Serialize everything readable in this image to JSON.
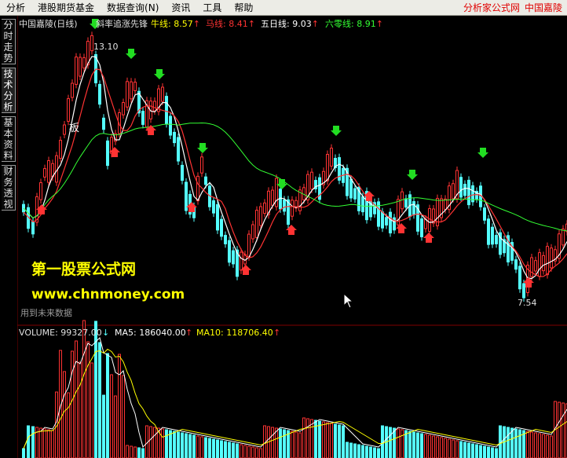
{
  "menu": {
    "items": [
      "分析",
      "港股期货基金",
      "数据查询(N)",
      "资讯",
      "工具",
      "帮助"
    ],
    "right_site": "分析家公式网",
    "right_stock": "中国嘉陵"
  },
  "side_tabs": [
    "分时走势",
    "技术分析",
    "基本资料",
    "财务透视"
  ],
  "header": {
    "stock": "中国嘉陵(日线)",
    "formula": "斜率追涨先锋",
    "lines": [
      {
        "label": "牛线:",
        "value": "8.57",
        "arrow": "↑",
        "color": "#ffff00"
      },
      {
        "label": "马线:",
        "value": "8.41",
        "arrow": "↑",
        "color": "#ff3333"
      },
      {
        "label": "五日线:",
        "value": "9.03",
        "arrow": "↑",
        "color": "#ffffff"
      },
      {
        "label": "六零线:",
        "value": "8.91",
        "arrow": "↑",
        "color": "#33ff33"
      }
    ]
  },
  "annotations": {
    "high_label": "13.10",
    "low_label": "7.54",
    "ban_label": "板",
    "future_data_note": "用到未来数据"
  },
  "watermark": {
    "line1": "第一股票公式网",
    "line2": "www.chnmoney.com"
  },
  "volume_header": {
    "volume_label": "VOLUME: 99327.00",
    "volume_arrow": "↓",
    "ma5_label": "MA5: 186040.00",
    "ma5_arrow": "↑",
    "ma10_label": "MA10: 118706.40",
    "ma10_arrow": "↑"
  },
  "colors": {
    "up": "#ff3333",
    "down": "#54ffff",
    "buy_arrow": "#ff3333",
    "sell_arrow": "#22dd22",
    "ma5": "#ffffff",
    "ma10": "#ff3333",
    "ma60": "#33ff33",
    "grid": "#800000"
  },
  "chart_data": {
    "type": "candlestick",
    "price_range": [
      7.54,
      13.1
    ],
    "buy_signal_count": 10,
    "sell_signal_count": 10
  }
}
